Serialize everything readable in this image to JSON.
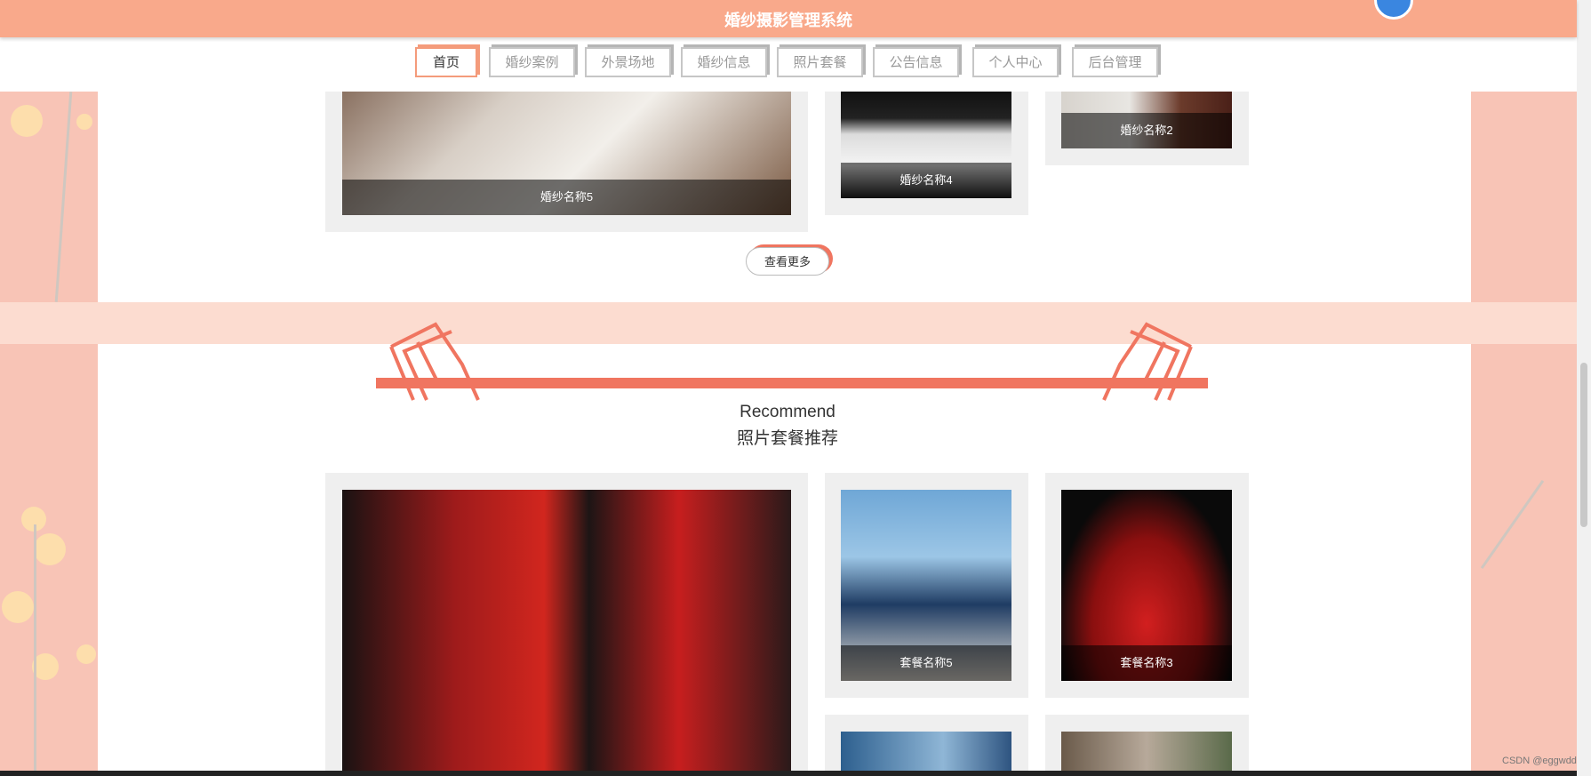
{
  "header": {
    "title": "婚纱摄影管理系统"
  },
  "nav": {
    "tabs": [
      {
        "label": "首页",
        "active": true
      },
      {
        "label": "婚纱案例"
      },
      {
        "label": "外景场地"
      },
      {
        "label": "婚纱信息"
      },
      {
        "label": "照片套餐"
      },
      {
        "label": "公告信息"
      },
      {
        "label": "个人中心"
      },
      {
        "label": "后台管理"
      }
    ]
  },
  "section1": {
    "cards": [
      {
        "caption": "婚纱名称5"
      },
      {
        "caption": "婚纱名称4"
      },
      {
        "caption": "婚纱名称2"
      }
    ],
    "more_label": "查看更多"
  },
  "section2": {
    "title_en": "Recommend",
    "title_cn": "照片套餐推荐",
    "cards": [
      {
        "caption": ""
      },
      {
        "caption": "套餐名称5"
      },
      {
        "caption": "套餐名称3"
      },
      {
        "caption": ""
      },
      {
        "caption": ""
      }
    ]
  },
  "watermark": "CSDN @eggwdd",
  "colors": {
    "header": "#f9a98b",
    "accent": "#f07560",
    "pink_bg": "#f8c4b6"
  }
}
